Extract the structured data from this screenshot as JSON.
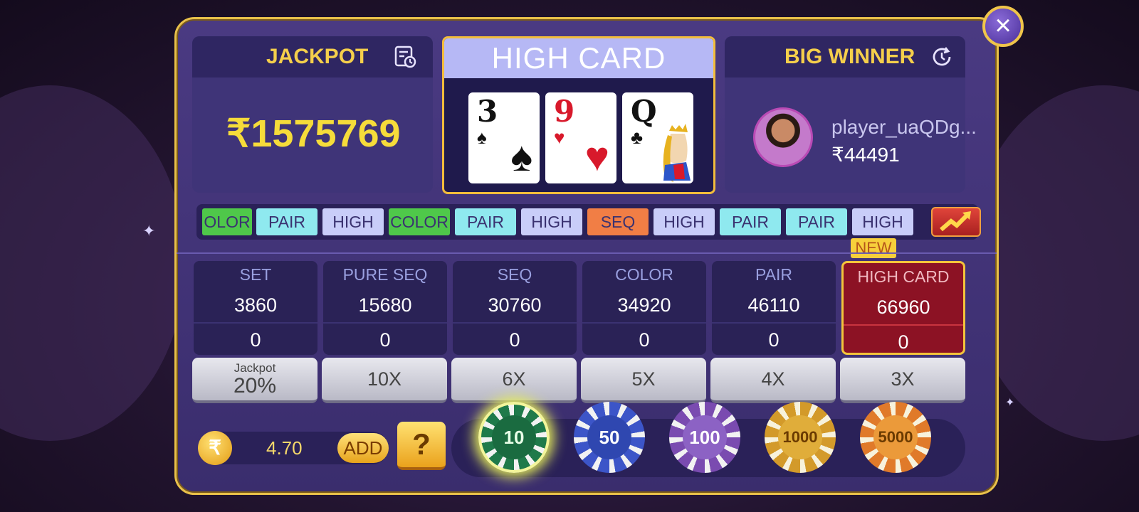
{
  "jackpot": {
    "title": "JACKPOT",
    "amount": "₹1575769"
  },
  "hand": {
    "title": "HIGH CARD",
    "cards": [
      {
        "rank": "3",
        "suit": "♠",
        "color": "#111111"
      },
      {
        "rank": "9",
        "suit": "♥",
        "color": "#d8192b"
      },
      {
        "rank": "Q",
        "suit": "♣",
        "color": "#111111"
      }
    ]
  },
  "big_winner": {
    "title": "BIG WINNER",
    "name": "player_uaQDg...",
    "amount": "₹44491"
  },
  "history": [
    {
      "label": "OLOR",
      "color": "#4fc84a"
    },
    {
      "label": "PAIR",
      "color": "#8fe9ef"
    },
    {
      "label": "HIGH",
      "color": "#c9cdf9"
    },
    {
      "label": "COLOR",
      "color": "#4fc84a"
    },
    {
      "label": "PAIR",
      "color": "#8fe9ef"
    },
    {
      "label": "HIGH",
      "color": "#c9cdf9"
    },
    {
      "label": "SEQ",
      "color": "#f17e45"
    },
    {
      "label": "HIGH",
      "color": "#c9cdf9"
    },
    {
      "label": "PAIR",
      "color": "#8fe9ef"
    },
    {
      "label": "PAIR",
      "color": "#8fe9ef"
    },
    {
      "label": "HIGH",
      "color": "#c9cdf9"
    }
  ],
  "new_tag": "NEW",
  "bets": [
    {
      "name": "SET",
      "total": "3860",
      "mine": "0",
      "multiplier": "",
      "selected": false
    },
    {
      "name": "PURE SEQ",
      "total": "15680",
      "mine": "0",
      "multiplier": "10X",
      "selected": false
    },
    {
      "name": "SEQ",
      "total": "30760",
      "mine": "0",
      "multiplier": "6X",
      "selected": false
    },
    {
      "name": "COLOR",
      "total": "34920",
      "mine": "0",
      "multiplier": "5X",
      "selected": false
    },
    {
      "name": "PAIR",
      "total": "46110",
      "mine": "0",
      "multiplier": "4X",
      "selected": false
    },
    {
      "name": "HIGH CARD",
      "total": "66960",
      "mine": "0",
      "multiplier": "3X",
      "selected": true
    }
  ],
  "jackpot_button": {
    "line1": "Jackpot",
    "line2": "20%"
  },
  "balance": {
    "currency": "₹",
    "value": "4.70",
    "add_label": "ADD"
  },
  "help_label": "?",
  "chips": [
    {
      "value": "10",
      "color": "#1f7a4a",
      "active": true
    },
    {
      "value": "50",
      "color": "#3c55c8",
      "active": false
    },
    {
      "value": "100",
      "color": "#7a4bb0",
      "active": false
    },
    {
      "value": "1000",
      "color": "#d39a2a",
      "active": false
    },
    {
      "value": "5000",
      "color": "#e07a2a",
      "active": false
    }
  ],
  "close_icon": "×"
}
